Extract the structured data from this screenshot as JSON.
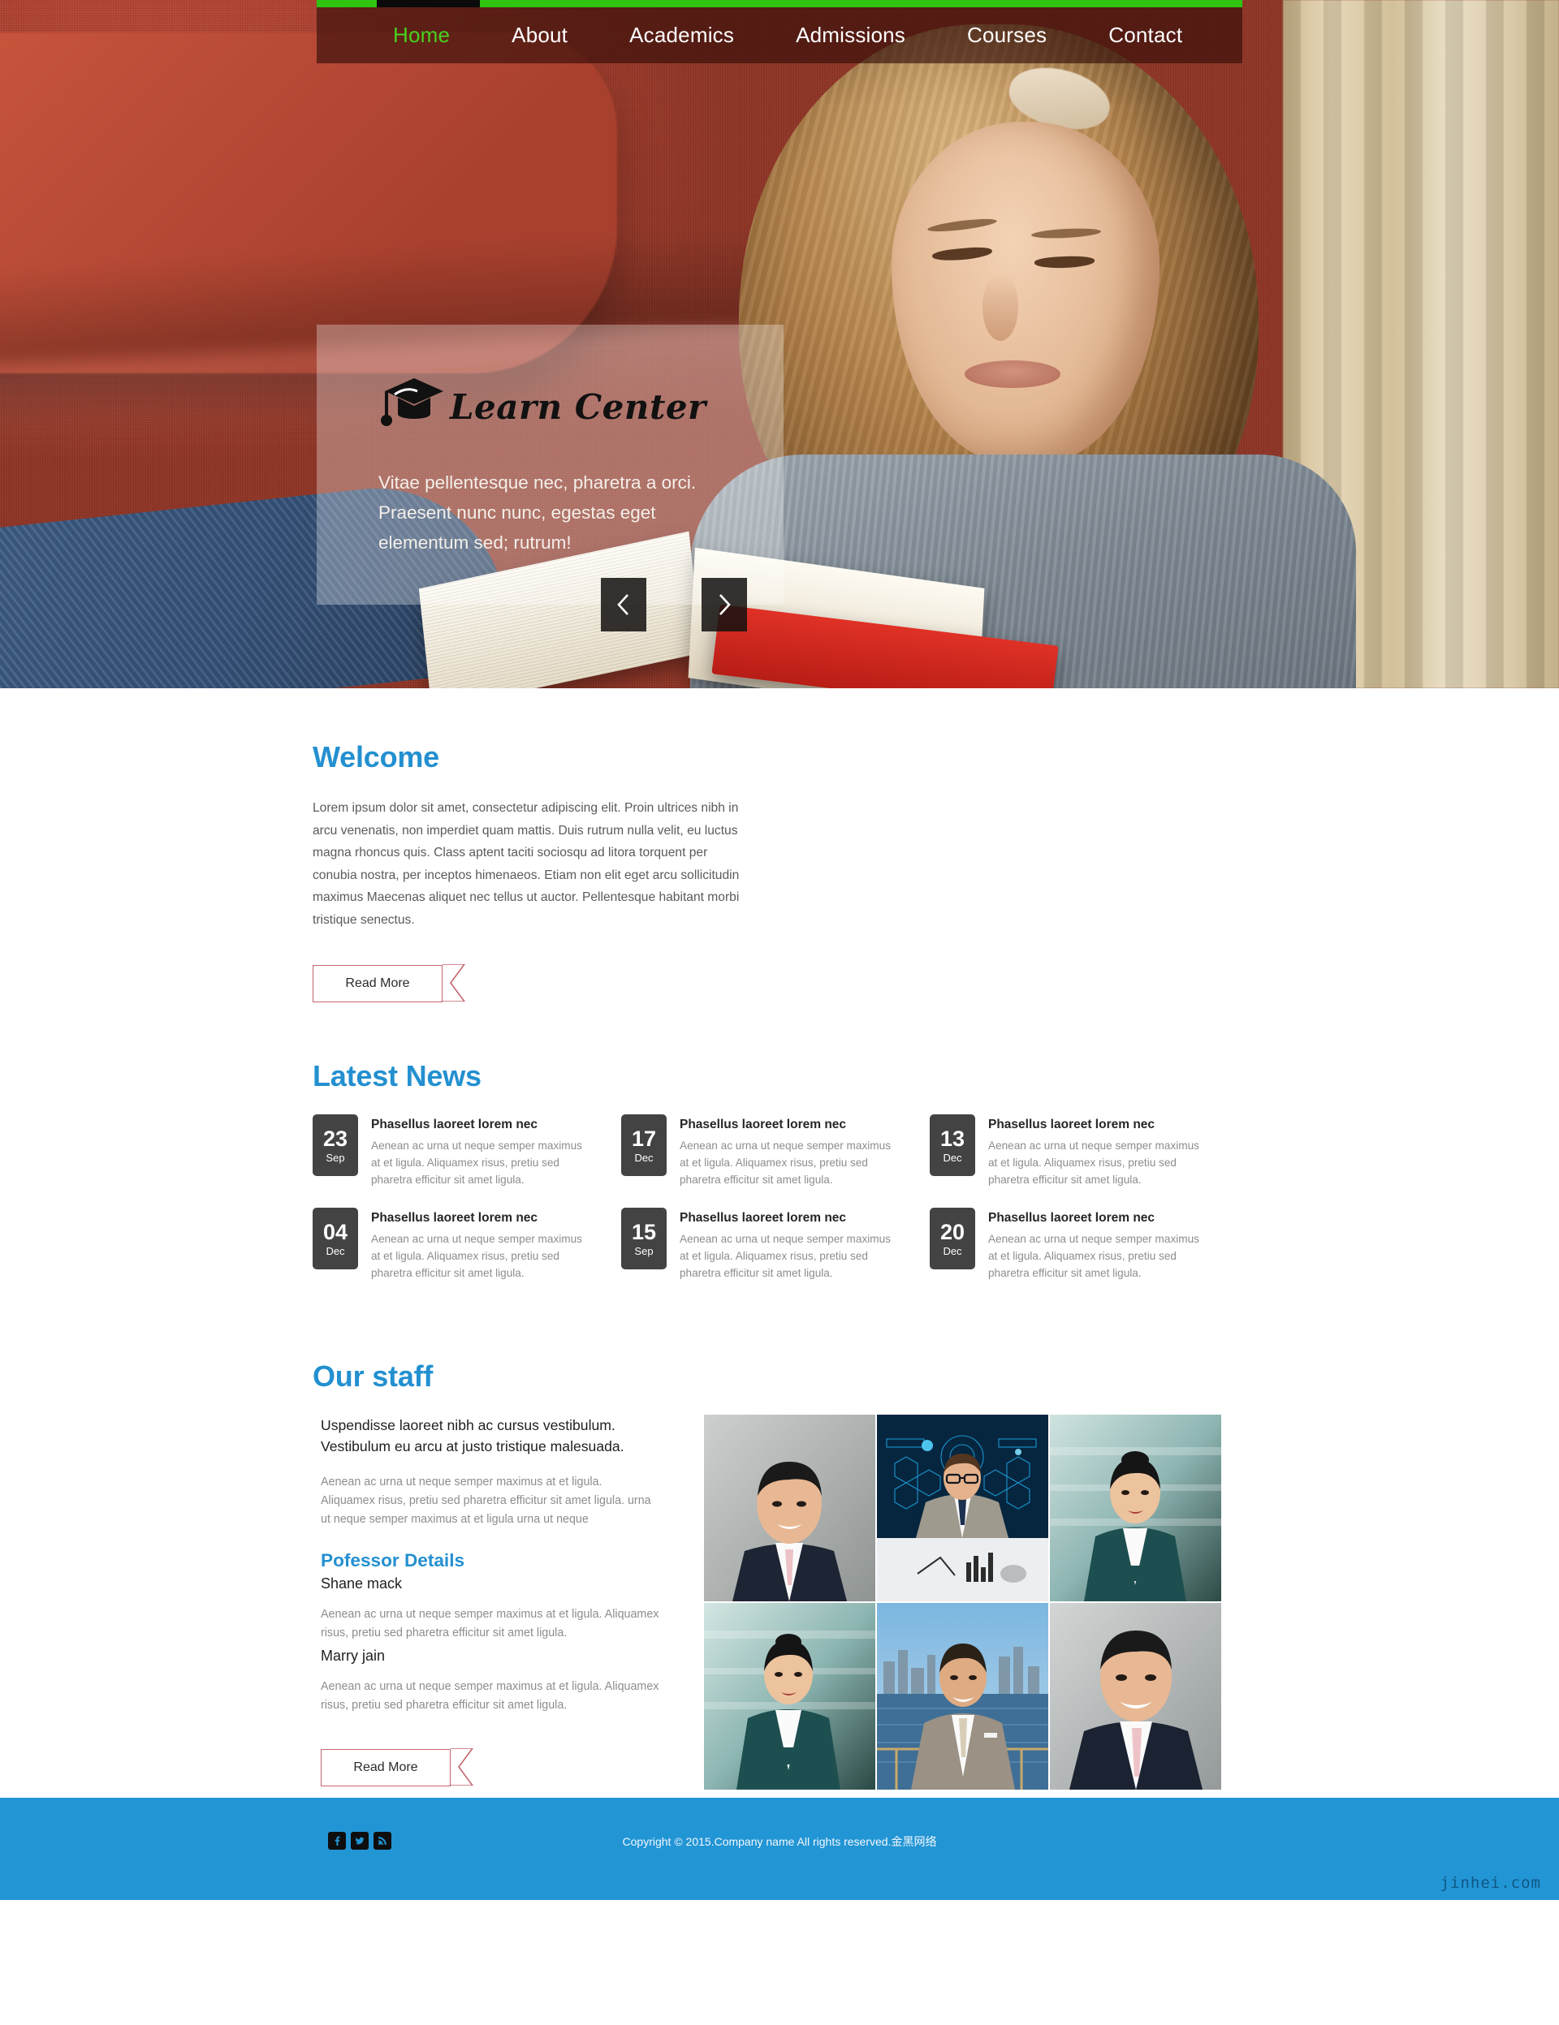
{
  "site": {
    "brand": "Learn Center",
    "accent_blue": "#2390d0",
    "accent_green": "#2ec40f",
    "footer_blue": "#2295d5"
  },
  "nav": {
    "items": [
      {
        "label": "Home",
        "active": true
      },
      {
        "label": "About",
        "active": false
      },
      {
        "label": "Academics",
        "active": false
      },
      {
        "label": "Admissions",
        "active": false
      },
      {
        "label": "Courses",
        "active": false
      },
      {
        "label": "Contact",
        "active": false
      }
    ]
  },
  "hero": {
    "logo_icon": "graduation-cap-icon",
    "title": "Learn Center",
    "caption_lines": "Vitae pellentesque nec, pharetra a orci. Praesent nunc nunc, egestas eget elementum sed; rutrum!",
    "prev_icon": "chevron-left-icon",
    "next_icon": "chevron-right-icon"
  },
  "welcome": {
    "title": "Welcome",
    "body": "Lorem ipsum dolor sit amet, consectetur adipiscing elit. Proin ultrices nibh in arcu venenatis, non imperdiet quam mattis. Duis rutrum nulla velit, eu luctus magna rhoncus quis. Class aptent taciti sociosqu ad litora torquent per conubia nostra, per inceptos himenaeos. Etiam non elit eget arcu sollicitudin maximus Maecenas aliquet nec tellus ut auctor. Pellentesque habitant morbi tristique senectus.",
    "read_more": "Read More"
  },
  "news": {
    "title": "Latest News",
    "items": [
      {
        "day": "23",
        "month": "Sep",
        "title": "Phasellus laoreet lorem nec",
        "desc": "Aenean ac urna ut neque semper maximus at et ligula. Aliquamex risus, pretiu sed pharetra efficitur sit amet ligula."
      },
      {
        "day": "17",
        "month": "Dec",
        "title": "Phasellus laoreet lorem nec",
        "desc": "Aenean ac urna ut neque semper maximus at et ligula. Aliquamex risus, pretiu sed pharetra efficitur sit amet ligula."
      },
      {
        "day": "13",
        "month": "Dec",
        "title": "Phasellus laoreet lorem nec",
        "desc": "Aenean ac urna ut neque semper maximus at et ligula. Aliquamex risus, pretiu sed pharetra efficitur sit amet ligula."
      },
      {
        "day": "04",
        "month": "Dec",
        "title": "Phasellus laoreet lorem nec",
        "desc": "Aenean ac urna ut neque semper maximus at et ligula. Aliquamex risus, pretiu sed pharetra efficitur sit amet ligula."
      },
      {
        "day": "15",
        "month": "Sep",
        "title": "Phasellus laoreet lorem nec",
        "desc": "Aenean ac urna ut neque semper maximus at et ligula. Aliquamex risus, pretiu sed pharetra efficitur sit amet ligula."
      },
      {
        "day": "20",
        "month": "Dec",
        "title": "Phasellus laoreet lorem nec",
        "desc": "Aenean ac urna ut neque semper maximus at et ligula. Aliquamex risus, pretiu sed pharetra efficitur sit amet ligula."
      }
    ]
  },
  "staff": {
    "title": "Our staff",
    "lead": "Uspendisse laoreet nibh ac cursus vestibulum. Vestibulum eu arcu at justo tristique malesuada.",
    "para": "Aenean ac urna ut neque semper maximus at et ligula. Aliquamex risus, pretiu sed pharetra efficitur sit amet ligula. urna ut neque semper maximus at et ligula urna ut neque",
    "professor_title": "Pofessor Details",
    "professors": [
      {
        "name": "Shane mack",
        "bio": "Aenean ac urna ut neque semper maximus at et ligula. Aliquamex risus, pretiu sed pharetra efficitur sit amet ligula."
      },
      {
        "name": "Marry jain",
        "bio": "Aenean ac urna ut neque semper maximus at et ligula. Aliquamex risus, pretiu sed pharetra efficitur sit amet ligula."
      }
    ],
    "read_more": "Read More",
    "gallery_prev_icon": "chevron-left-icon",
    "gallery_next_icon": "chevron-right-icon",
    "gallery_count": 6
  },
  "footer": {
    "social": [
      {
        "name": "facebook-icon",
        "glyph": "f"
      },
      {
        "name": "twitter-icon",
        "glyph": "t"
      },
      {
        "name": "rss-icon",
        "glyph": "r"
      }
    ],
    "copyright": "Copyright © 2015.Company name All rights reserved.金黑网络",
    "watermark": "jinhei.com"
  }
}
